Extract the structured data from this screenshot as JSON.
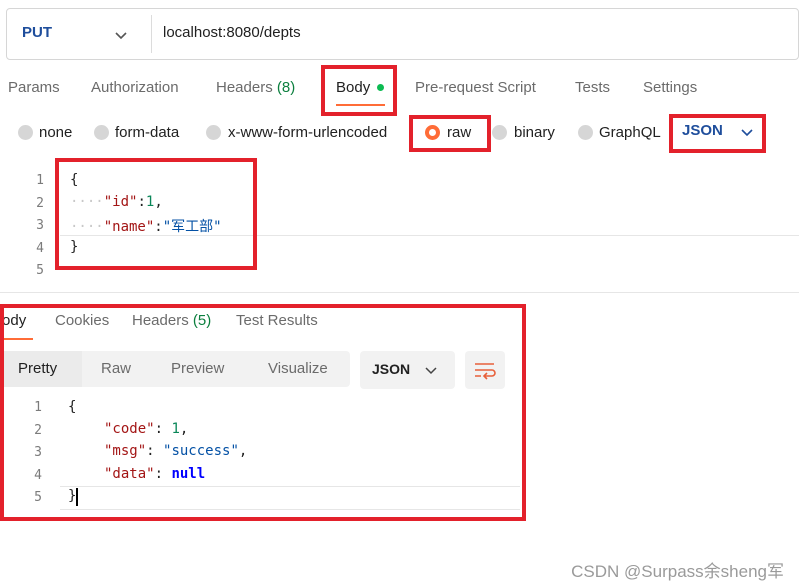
{
  "request": {
    "method": "PUT",
    "url": "localhost:8080/depts"
  },
  "request_tabs": [
    {
      "label": "Params"
    },
    {
      "label": "Authorization"
    },
    {
      "label": "Headers",
      "count": "(8)"
    },
    {
      "label": "Body"
    },
    {
      "label": "Pre-request Script"
    },
    {
      "label": "Tests"
    },
    {
      "label": "Settings"
    }
  ],
  "body_types": [
    "none",
    "form-data",
    "x-www-form-urlencoded",
    "raw",
    "binary",
    "GraphQL"
  ],
  "body_format": "JSON",
  "request_body": {
    "line_numbers": [
      "1",
      "2",
      "3",
      "4",
      "5"
    ],
    "open": "{",
    "indent": "····",
    "id_key": "\"id\"",
    "id_value": "1",
    "name_key": "\"name\"",
    "name_value": "\"军工部\"",
    "close": "}"
  },
  "response_tabs": [
    {
      "label": "Body"
    },
    {
      "label": "Cookies"
    },
    {
      "label": "Headers",
      "count": "(5)"
    },
    {
      "label": "Test Results"
    }
  ],
  "view_modes": [
    "Pretty",
    "Raw",
    "Preview",
    "Visualize"
  ],
  "response_format": "JSON",
  "response_body": {
    "line_numbers": [
      "1",
      "2",
      "3",
      "4",
      "5"
    ],
    "open": "{",
    "code_key": "\"code\"",
    "code_value": "1",
    "msg_key": "\"msg\"",
    "msg_value": "\"success\"",
    "data_key": "\"data\"",
    "data_value": "null",
    "close": "}"
  },
  "watermark": "CSDN @Surpass余sheng军",
  "colors": {
    "accent": "#ff6c37",
    "highlight": "#e3212b",
    "method": "#1f4e9c",
    "count": "#0b7f3e"
  }
}
